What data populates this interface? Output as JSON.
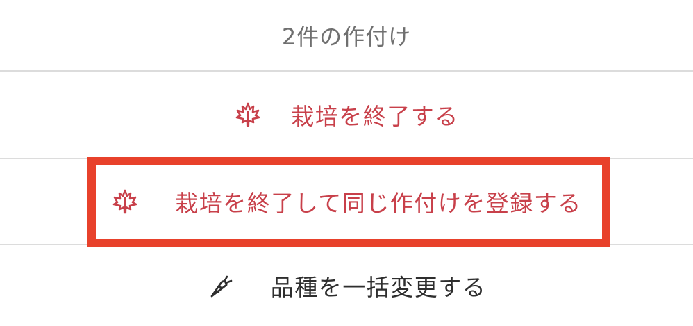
{
  "header": {
    "title": "2件の作付け"
  },
  "actions": [
    {
      "icon": "maple-leaf-icon",
      "label": "栽培を終了する",
      "color": "#c8404a"
    },
    {
      "icon": "maple-leaf-icon",
      "label": "栽培を終了して同じ作付けを登録する",
      "color": "#c8404a"
    },
    {
      "icon": "carrot-icon",
      "label": "品種を一括変更する",
      "color": "#2e2e2e"
    }
  ],
  "colors": {
    "danger": "#c8404a",
    "highlight": "#e8412b",
    "divider": "#dcdcdc",
    "muted_text": "#6f6f6f"
  }
}
